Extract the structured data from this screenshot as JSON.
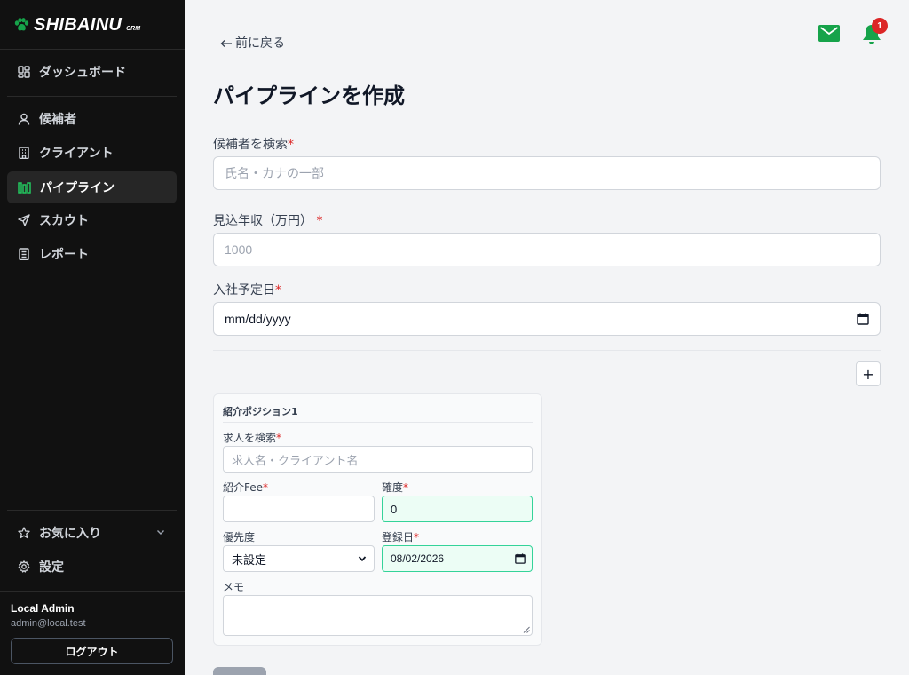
{
  "app": {
    "logo": "SHIBAINU",
    "logo_sub": "CRM"
  },
  "sidebar": {
    "dashboard": "ダッシュボード",
    "items": [
      {
        "label": "候補者",
        "icon": "user-icon"
      },
      {
        "label": "クライアント",
        "icon": "building-icon"
      },
      {
        "label": "パイプライン",
        "icon": "pipeline-icon",
        "active": true
      },
      {
        "label": "スカウト",
        "icon": "send-icon"
      },
      {
        "label": "レポート",
        "icon": "report-icon"
      }
    ],
    "favorites": "お気に入り",
    "settings": "設定"
  },
  "user": {
    "name": "Local Admin",
    "email": "admin@local.test",
    "logout": "ログアウト"
  },
  "header": {
    "back": "前に戻る",
    "notification_count": "1"
  },
  "page": {
    "title": "パイプラインを作成"
  },
  "form": {
    "candidate": {
      "label": "候補者を検索",
      "placeholder": "氏名・カナの一部"
    },
    "salary": {
      "label": "見込年収（万円）",
      "placeholder": "1000"
    },
    "start_date": {
      "label": "入社予定日",
      "value": "mm/dd/yyyy"
    },
    "add_button": "+",
    "position_card": {
      "title": "紹介ポジション1",
      "job_search": {
        "label": "求人を検索",
        "placeholder": "求人名・クライアント名"
      },
      "fee": {
        "label": "紹介Fee",
        "value": ""
      },
      "confidence": {
        "label": "確度",
        "value": "0"
      },
      "priority": {
        "label": "優先度",
        "value": "未設定"
      },
      "registered": {
        "label": "登録日",
        "value": "08/02/2026"
      },
      "memo": {
        "label": "メモ",
        "value": ""
      }
    }
  },
  "colors": {
    "accent": "#16a34a",
    "sidebar_bg": "#111111",
    "badge": "#dc2626"
  }
}
